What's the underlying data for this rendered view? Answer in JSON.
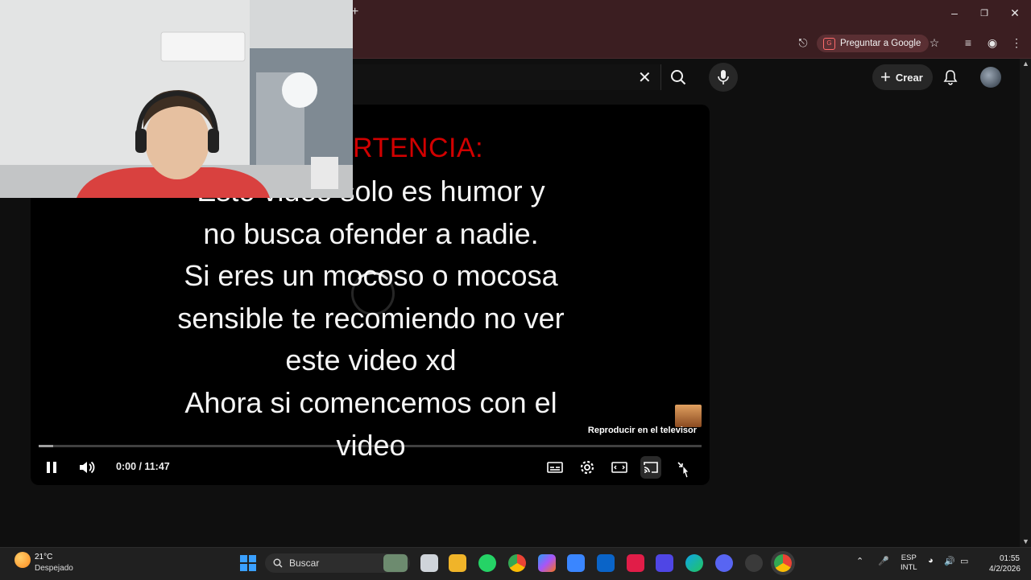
{
  "browser": {
    "ask_google_label": "Preguntar a Google"
  },
  "youtube": {
    "create_label": "Crear"
  },
  "video": {
    "warning_title": "RTENCIA:",
    "text_lines": [
      "Esto video solo es humor y",
      "no busca ofender a nadie.",
      "Si eres un mocoso o mocosa",
      "sensible te recomiendo no ver",
      "este video xd",
      "Ahora si comencemos con el",
      "video"
    ],
    "cast_label": "Reproducir en el televisor",
    "time_display": "0:00 / 11:47",
    "progress_fraction": 0.0,
    "accent_color": "#ff0000"
  },
  "taskbar": {
    "weather_temp": "21°C",
    "weather_desc": "Despejado",
    "search_label": "Buscar",
    "lang_top": "ESP",
    "lang_bottom": "INTL",
    "time": "01:55",
    "date": "4/2/2026"
  }
}
